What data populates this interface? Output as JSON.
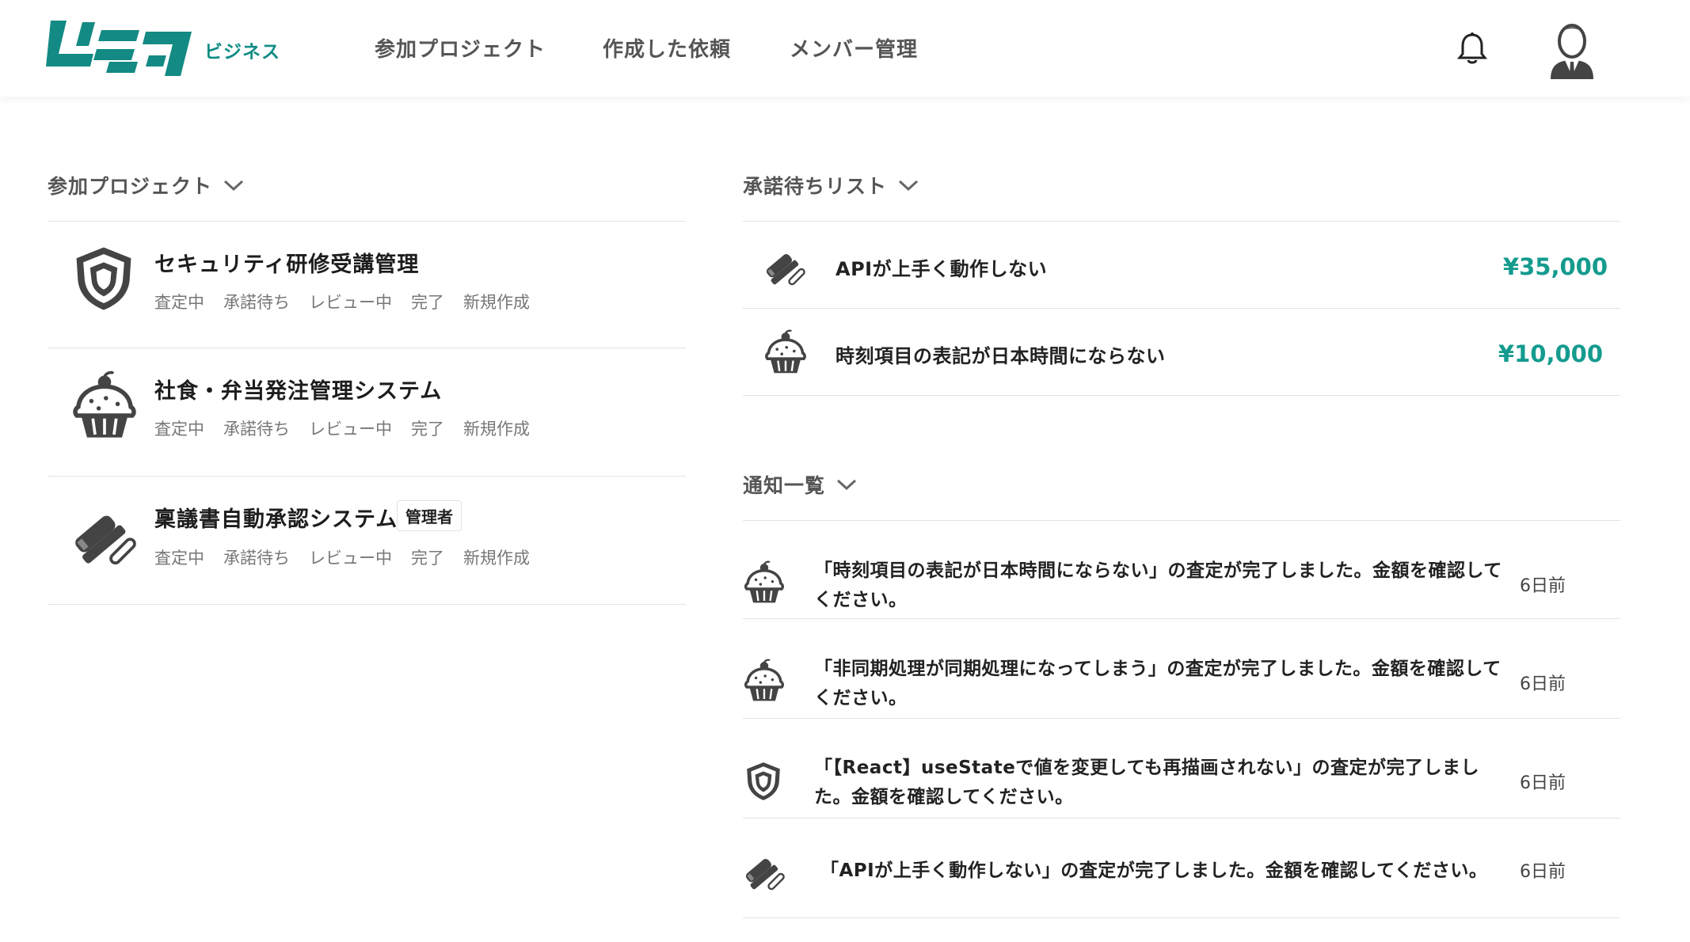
{
  "header": {
    "logo_sub": "ビジネス",
    "nav": [
      "参加プロジェクト",
      "作成した依頼",
      "メンバー管理"
    ]
  },
  "projects": {
    "title": "参加プロジェクト",
    "items": [
      {
        "icon": "shield-icon",
        "title": "セキュリティ研修受講管理",
        "badge": "",
        "statuses": [
          "査定中",
          "承諾待ち",
          "レビュー中",
          "完了",
          "新規作成"
        ]
      },
      {
        "icon": "cupcake-icon",
        "title": "社食・弁当発注管理システム",
        "badge": "",
        "statuses": [
          "査定中",
          "承諾待ち",
          "レビュー中",
          "完了",
          "新規作成"
        ]
      },
      {
        "icon": "stamp-pen-icon",
        "title": "稟議書自動承認システム",
        "badge": "管理者",
        "statuses": [
          "査定中",
          "承諾待ち",
          "レビュー中",
          "完了",
          "新規作成"
        ]
      }
    ]
  },
  "pending": {
    "title": "承諾待ちリスト",
    "items": [
      {
        "icon": "stamp-pen-icon",
        "title": "APIが上手く動作しない",
        "amount": "¥35,000"
      },
      {
        "icon": "cupcake-icon",
        "title": "時刻項目の表記が日本時間にならない",
        "amount": "¥10,000"
      }
    ]
  },
  "notifications": {
    "title": "通知一覧",
    "items": [
      {
        "icon": "cupcake-icon",
        "text": "「時刻項目の表記が日本時間にならない」の査定が完了しました。金額を確認してください。",
        "time": "6日前"
      },
      {
        "icon": "cupcake-icon",
        "text": "「非同期処理が同期処理になってしまう」の査定が完了しました。金額を確認してください。",
        "time": "6日前"
      },
      {
        "icon": "shield-icon",
        "text": "「【React】useStateで値を変更しても再描画されない」の査定が完了しました。金額を確認してください。",
        "time": "6日前"
      },
      {
        "icon": "stamp-pen-icon",
        "text": "「APIが上手く動作しない」の査定が完了しました。金額を確認してください。",
        "time": "6日前"
      }
    ]
  }
}
